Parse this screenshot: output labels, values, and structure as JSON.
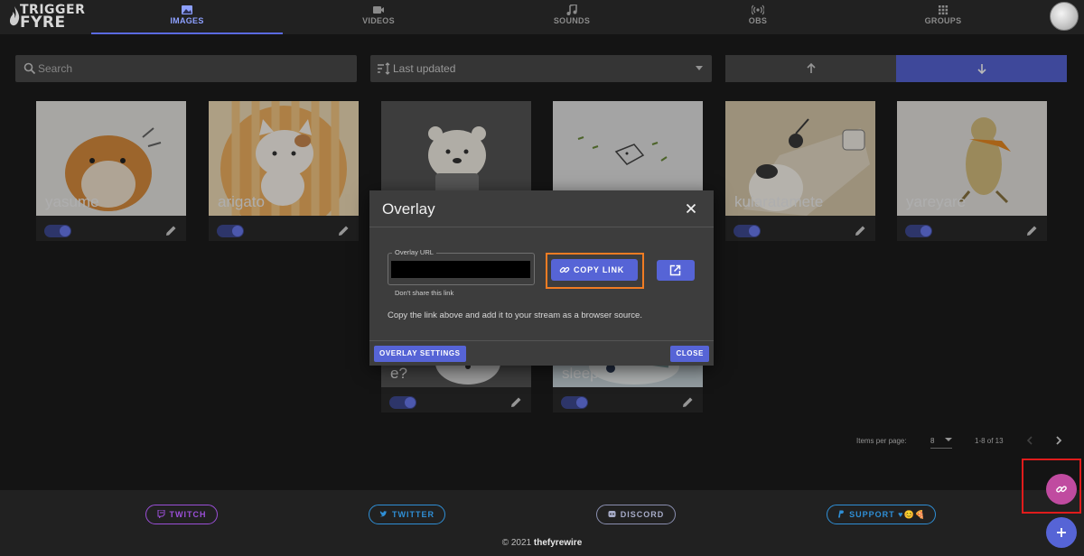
{
  "brand": {
    "line1": "TRIGGER",
    "line2": "FYRE"
  },
  "nav": {
    "tabs": [
      {
        "label": "IMAGES",
        "icon": "image-icon",
        "active": true
      },
      {
        "label": "VIDEOS",
        "icon": "video-icon",
        "active": false
      },
      {
        "label": "SOUNDS",
        "icon": "music-note-icon",
        "active": false
      },
      {
        "label": "OBS",
        "icon": "broadcast-icon",
        "active": false
      },
      {
        "label": "GROUPS",
        "icon": "grid-icon",
        "active": false
      }
    ]
  },
  "toolbar": {
    "search_placeholder": "Search",
    "sort_value": "Last updated",
    "sort_direction": "descending"
  },
  "cards": [
    {
      "name": "yasume",
      "enabled": true
    },
    {
      "name": "arigato",
      "enabled": true
    },
    {
      "name": "",
      "enabled": true
    },
    {
      "name": "",
      "enabled": true
    },
    {
      "name": "kuiaratamete",
      "enabled": true
    },
    {
      "name": "yareyare",
      "enabled": true
    },
    {
      "name": "e?",
      "enabled": true
    },
    {
      "name": "sleep",
      "enabled": true
    }
  ],
  "pagination": {
    "items_per_page_label": "Items per page:",
    "items_per_page": "8",
    "range": "1-8 of 13"
  },
  "modal": {
    "title": "Overlay",
    "url_label": "Overlay URL",
    "url_helper": "Don't share this link",
    "copy_label": "COPY LINK",
    "info": "Copy the link above and add it to your stream as a browser source.",
    "settings_label": "OVERLAY SETTINGS",
    "close_label": "CLOSE"
  },
  "footer": {
    "links": [
      {
        "label": "TWITCH",
        "icon": "twitch-icon",
        "color": "#9b4fd8"
      },
      {
        "label": "TWITTER",
        "icon": "twitter-icon",
        "color": "#2f8fd6"
      },
      {
        "label": "DISCORD",
        "icon": "discord-icon",
        "color": "#8a8fb0"
      },
      {
        "label": "SUPPORT ♥😊🍕",
        "icon": "paypal-icon",
        "color": "#2f8fd6"
      }
    ],
    "copyright_prefix": "© 2021",
    "copyright_name": "thefyrewire"
  },
  "colors": {
    "accent": "#5664d6",
    "pink_fab": "#c04ba0",
    "highlight_orange": "#f07c23",
    "highlight_red": "#e01c1c"
  }
}
